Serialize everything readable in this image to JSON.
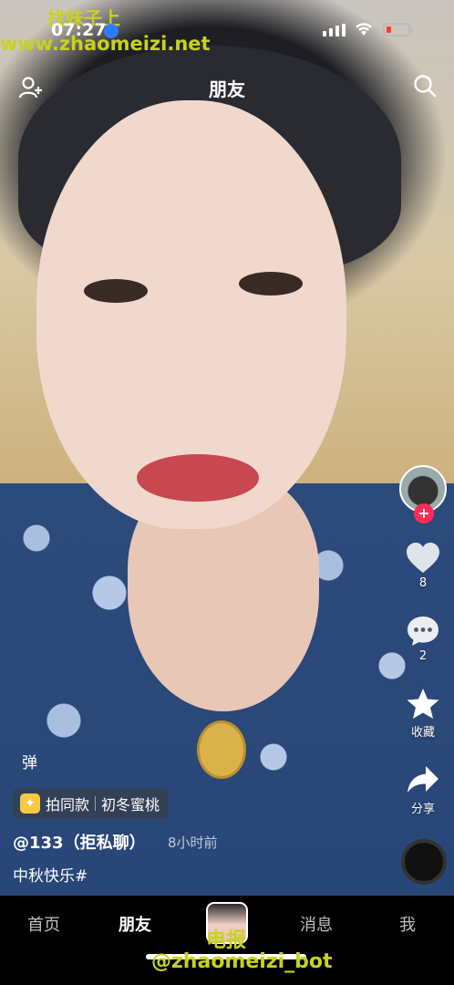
{
  "watermark": {
    "top": "找妹子上",
    "url": "www.zhaomeizi.net",
    "bottom_line1": "电报",
    "bottom_line2": "@zhaomeizi_bot"
  },
  "status_bar": {
    "time": "07:27"
  },
  "top_bar": {
    "title": "朋友"
  },
  "rail": {
    "like_count": "8",
    "comment_count": "2",
    "favorite_label": "收藏",
    "share_label": "分享",
    "follow_symbol": "+"
  },
  "overlay": {
    "danmu_label": "弹",
    "same_style_label": "拍同款",
    "same_style_name": "初冬蜜桃",
    "author": "@133（拒私聊）",
    "time_ago": "8小时前",
    "caption": "中秋快乐#"
  },
  "tabbar": {
    "tabs": [
      "首页",
      "朋友",
      "消息",
      "我"
    ]
  },
  "colors": {
    "accent": "#fe2c55",
    "watermark": "#c8d21f"
  }
}
